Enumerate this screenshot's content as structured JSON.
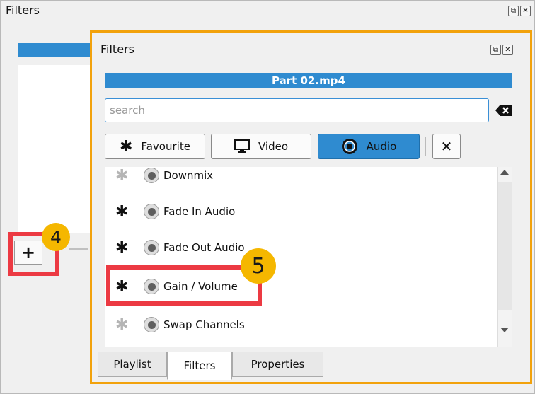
{
  "outer_panel": {
    "title": "Filters",
    "add_button": "+"
  },
  "float_panel": {
    "title": "Filters",
    "header": "Part 02.mp4",
    "search": {
      "value": "",
      "placeholder": "search"
    },
    "buttons": {
      "favourite": "Favourite",
      "video": "Video",
      "audio": "Audio",
      "close": "✕"
    },
    "filters": [
      {
        "label": "Downmix",
        "favourite": false
      },
      {
        "label": "Fade In Audio",
        "favourite": true
      },
      {
        "label": "Fade Out Audio",
        "favourite": true
      },
      {
        "label": "Gain / Volume",
        "favourite": true
      },
      {
        "label": "Swap Channels",
        "favourite": false
      }
    ],
    "tabs": {
      "playlist": "Playlist",
      "filters": "Filters",
      "properties": "Properties"
    }
  },
  "annotations": {
    "badge_a": "4",
    "badge_b": "5"
  },
  "colors": {
    "accent_blue": "#2f8bd0",
    "highlight_red": "#ec3a43",
    "badge_yellow": "#f5b700",
    "panel_orange": "#f2a20c"
  }
}
